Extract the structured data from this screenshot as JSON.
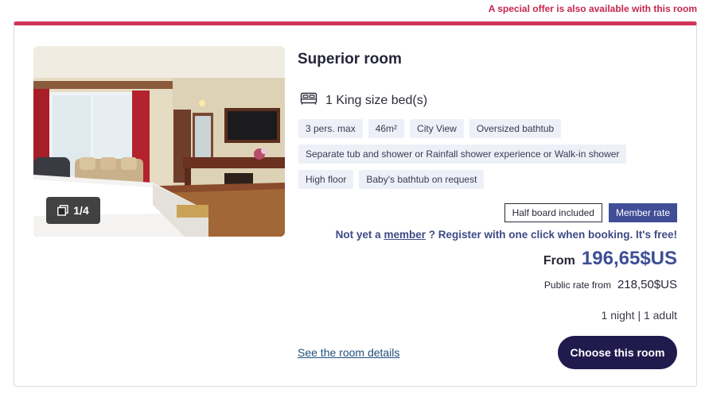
{
  "offer_banner": "A special offer is also available with this room",
  "room": {
    "title": "Superior room",
    "bed": "1 King size bed(s)",
    "bed_icon": "bed-icon",
    "photo_counter": "1/4",
    "gallery_icon": "gallery-icon",
    "tags": [
      [
        "3 pers. max",
        "46m²",
        "City View",
        "Oversized bathtub"
      ],
      [
        "Separate tub and shower or Rainfall shower experience or Walk-in shower"
      ],
      [
        "High floor",
        "Baby's bathtub on request"
      ]
    ]
  },
  "rate": {
    "badge_board": "Half board included",
    "badge_member": "Member rate",
    "member_prefix": "Not yet a",
    "member_link": "member",
    "member_suffix": "? Register with one click when booking. It's free!",
    "from_label": "From",
    "price": "196,65$US",
    "public_label": "Public rate from",
    "public_price": "218,50$US",
    "stay": "1 night | 1 adult"
  },
  "actions": {
    "details_link": "See the room details",
    "choose_button": "Choose this room"
  },
  "colors": {
    "accent_red": "#d1345b",
    "member_blue": "#3f4e96",
    "button_dark": "#211a4d"
  }
}
